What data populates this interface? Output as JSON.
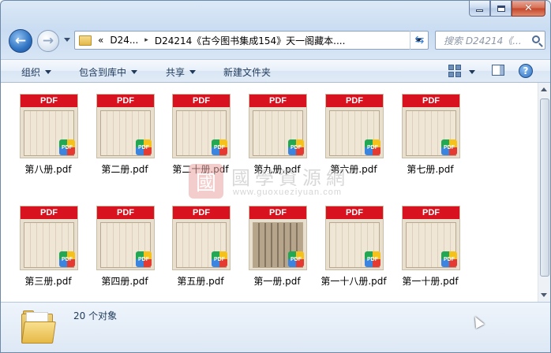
{
  "window": {
    "controls": {
      "minimize": "minimize",
      "maximize": "maximize",
      "close": "✕"
    }
  },
  "nav": {
    "back_icon": "back-arrow-icon",
    "forward_icon": "forward-arrow-icon",
    "breadcrumb": {
      "prefix": "«",
      "parent": "D24...",
      "separator": "▸",
      "current": "D24214《古今图书集成154》天一阁藏本...."
    },
    "search_placeholder": "搜索 D24214《..."
  },
  "toolbar": {
    "organize": "组织",
    "include_library": "包含到库中",
    "share": "共享",
    "new_folder": "新建文件夹"
  },
  "files": [
    {
      "name": "第八册.pdf",
      "band": "PDF",
      "badge": "PDF",
      "dark": false
    },
    {
      "name": "第二册.pdf",
      "band": "PDF",
      "badge": "PDF",
      "dark": false
    },
    {
      "name": "第二十册.pdf",
      "band": "PDF",
      "badge": "PDF",
      "dark": false
    },
    {
      "name": "第九册.pdf",
      "band": "PDF",
      "badge": "PDF",
      "dark": false
    },
    {
      "name": "第六册.pdf",
      "band": "PDF",
      "badge": "PDF",
      "dark": false
    },
    {
      "name": "第七册.pdf",
      "band": "PDF",
      "badge": "PDF",
      "dark": false
    },
    {
      "name": "第三册.pdf",
      "band": "PDF",
      "badge": "PDF",
      "dark": false
    },
    {
      "name": "第四册.pdf",
      "band": "PDF",
      "badge": "PDF",
      "dark": false
    },
    {
      "name": "第五册.pdf",
      "band": "PDF",
      "badge": "PDF",
      "dark": false
    },
    {
      "name": "第一册.pdf",
      "band": "PDF",
      "badge": "PDF",
      "dark": true
    },
    {
      "name": "第一十八册.pdf",
      "band": "PDF",
      "badge": "PDF",
      "dark": false
    },
    {
      "name": "第一十册.pdf",
      "band": "PDF",
      "badge": "PDF",
      "dark": false
    }
  ],
  "watermark": {
    "logo": "國",
    "title": "國學資源網",
    "url": "www.guoxueziyuan.com"
  },
  "details": {
    "count_text": "20 个对象"
  }
}
